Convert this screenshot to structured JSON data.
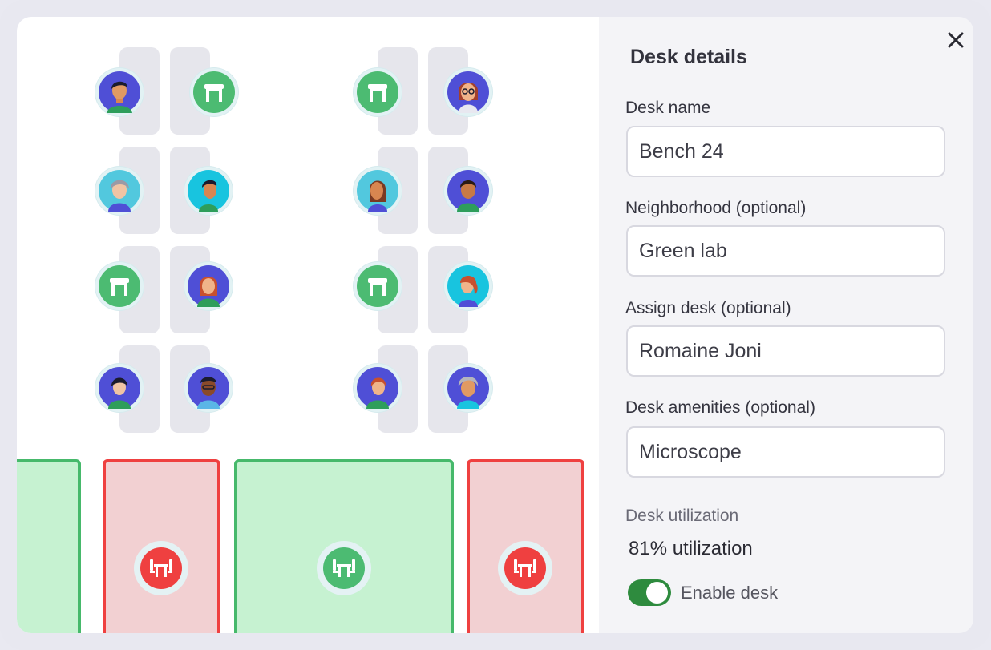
{
  "panel": {
    "title": "Desk details",
    "close_icon": "close-icon",
    "fields": {
      "desk_name": {
        "label": "Desk name",
        "value": "Bench 24"
      },
      "neighborhood": {
        "label": "Neighborhood (optional)",
        "value": "Green lab"
      },
      "assign": {
        "label": "Assign desk (optional)",
        "value": "Romaine Joni"
      },
      "amenities": {
        "label": "Desk amenities (optional)",
        "value": "Microscope"
      }
    },
    "utilization": {
      "label": "Desk utilization",
      "value": "81% utilization"
    },
    "enable": {
      "label": "Enable desk",
      "checked": true
    }
  },
  "floor_map": {
    "desk_groups": [
      {
        "seats": [
          "avatar",
          "available",
          "avatar",
          "avatar",
          "available",
          "avatar",
          "avatar",
          "avatar"
        ]
      },
      {
        "seats": [
          "available",
          "avatar",
          "avatar",
          "avatar",
          "available",
          "avatar",
          "avatar",
          "avatar"
        ]
      }
    ],
    "rooms": [
      {
        "status": "available",
        "icon": "meeting-room-icon"
      },
      {
        "status": "occupied",
        "icon": "meeting-room-icon"
      },
      {
        "status": "available",
        "icon": "meeting-room-icon"
      },
      {
        "status": "occupied",
        "icon": "meeting-room-icon"
      }
    ]
  },
  "colors": {
    "available": "#4cbb72",
    "occupied": "#ef4040",
    "toggle_on": "#2e8b3e"
  }
}
